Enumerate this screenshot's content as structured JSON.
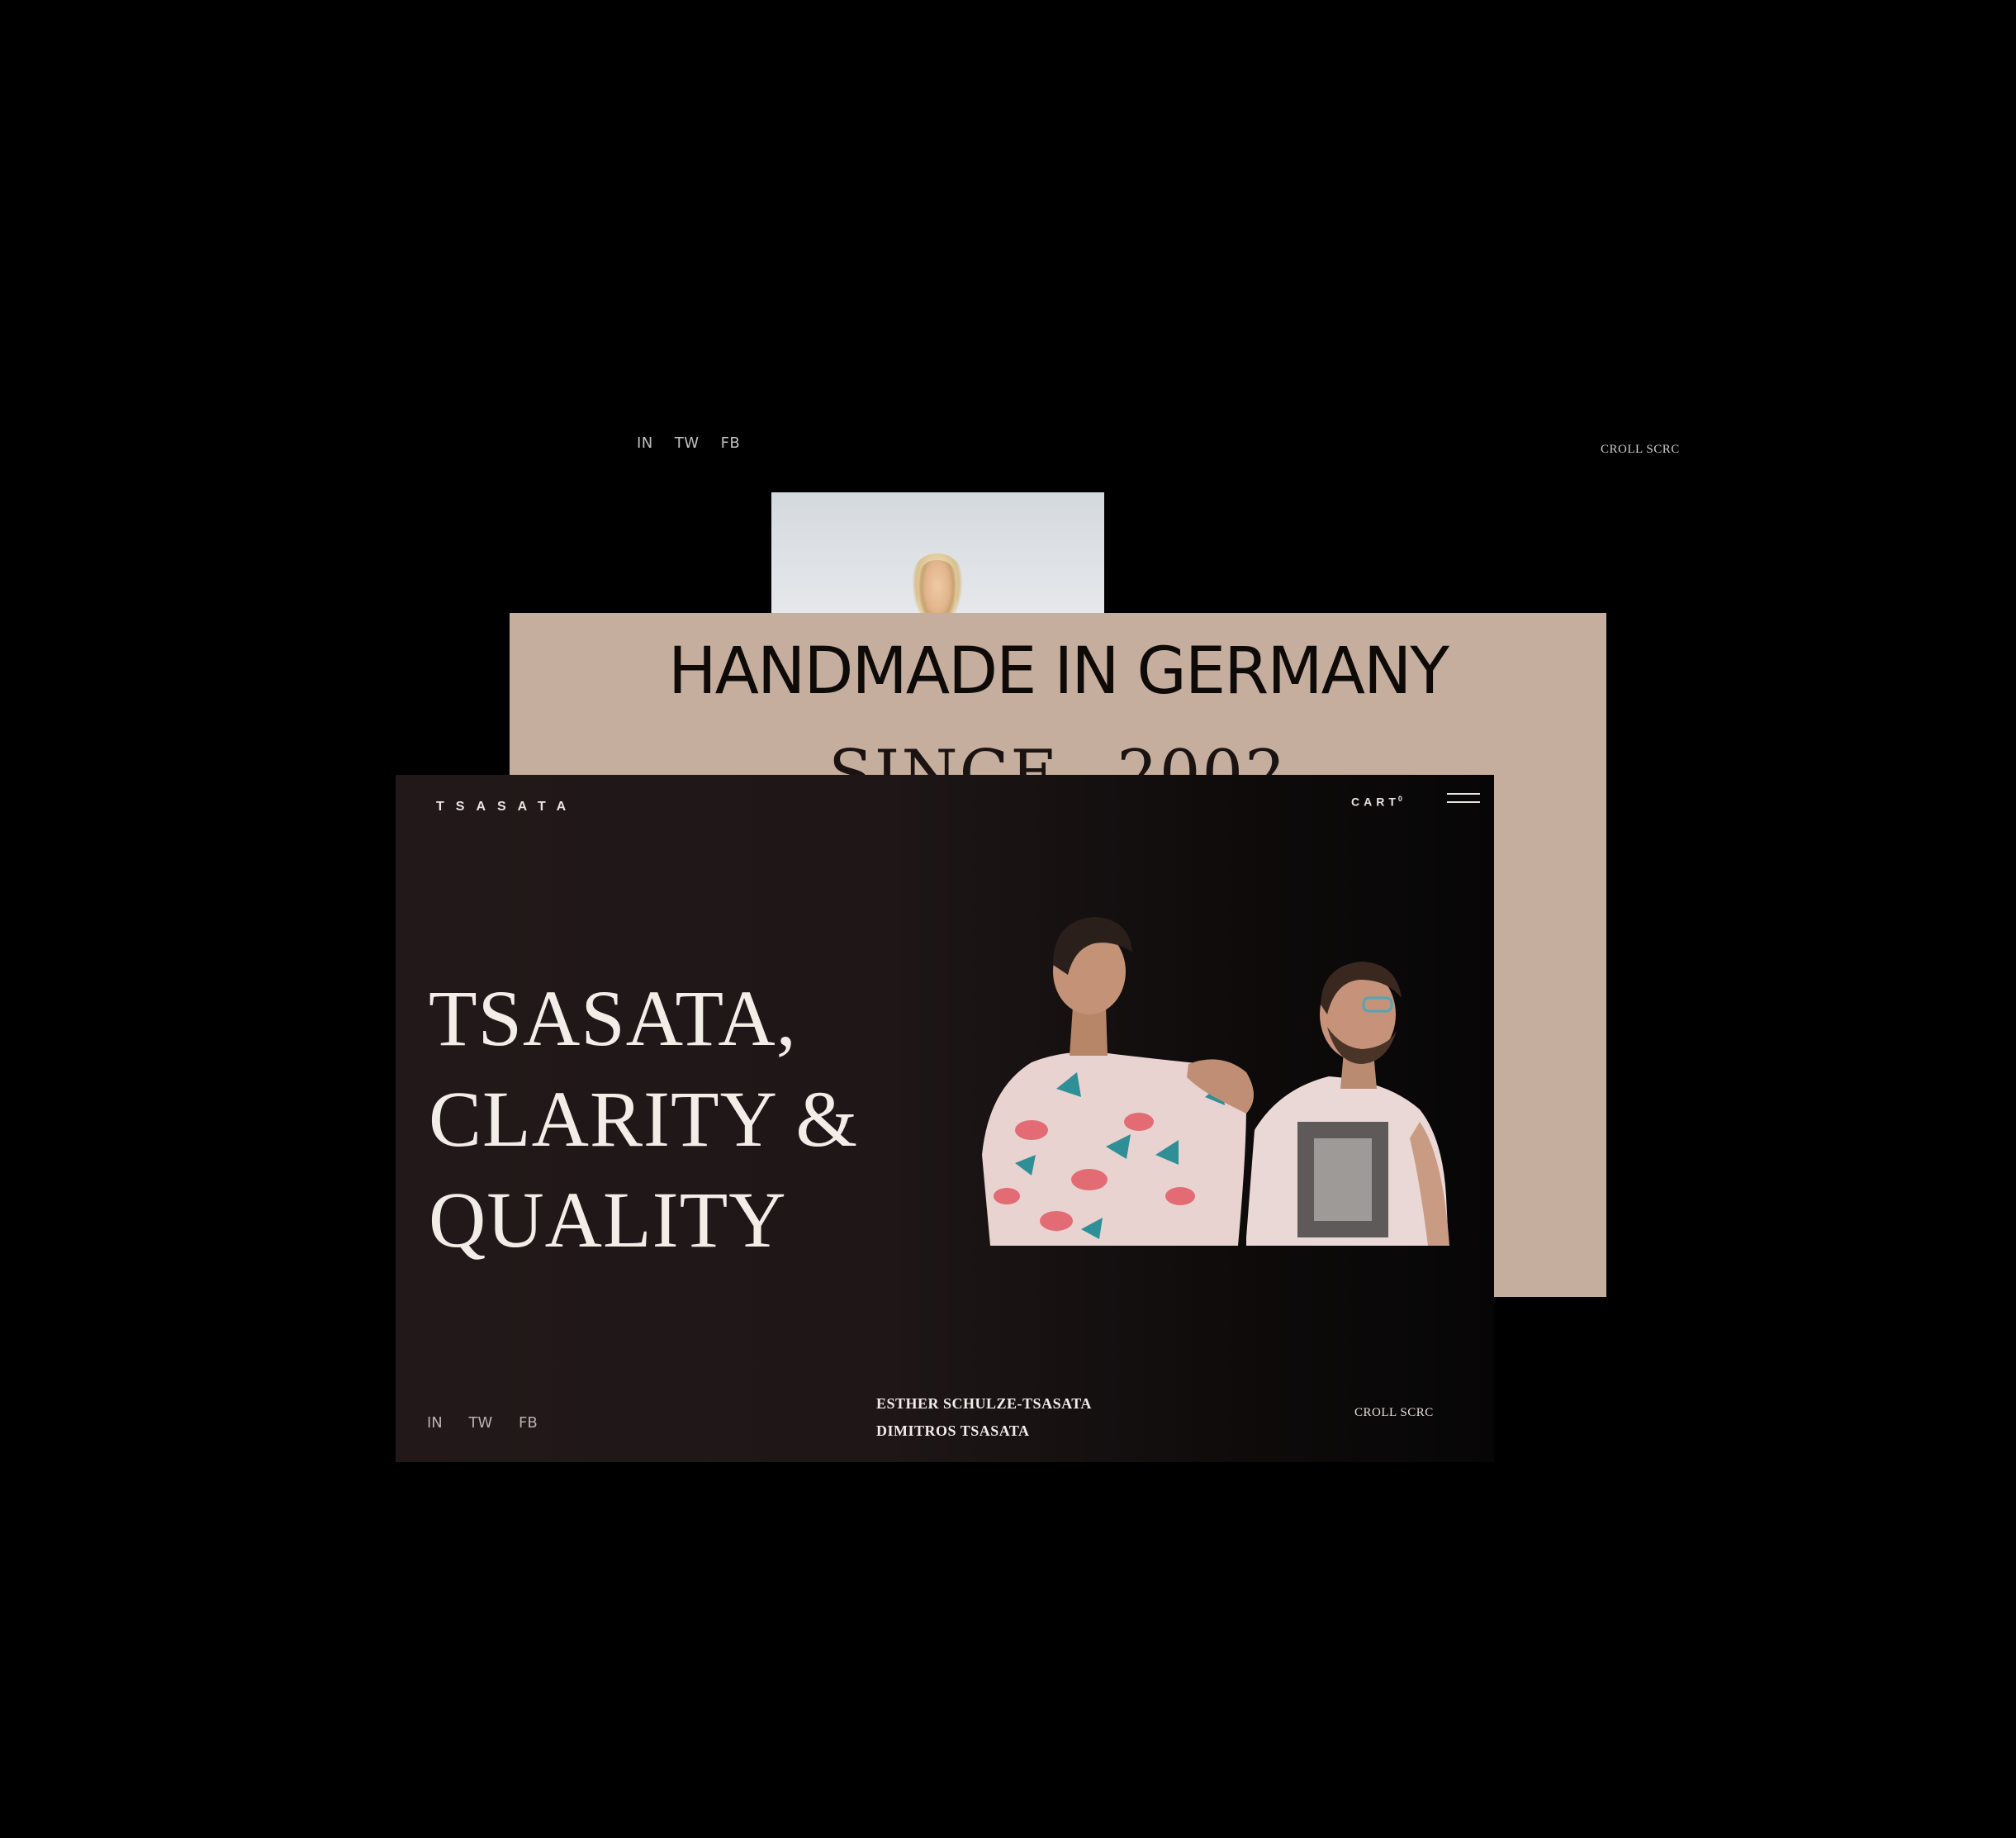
{
  "back_layer": {
    "social": [
      "IN",
      "TW",
      "FB"
    ],
    "scroll_label": "CROLL SCRC"
  },
  "beige_panel": {
    "title": "HANDMADE IN GERMANY",
    "since_label": "SINCE",
    "since_year": "2002"
  },
  "header": {
    "logo": "TSASATA",
    "cart_label": "CART",
    "cart_count": "0"
  },
  "hero": {
    "line1": "TSASATA,",
    "line2": "CLARITY &",
    "line3": "QUALITY"
  },
  "footer": {
    "social": [
      "IN",
      "TW",
      "FB"
    ],
    "names": [
      "ESTHER SCHULZE-TSASATA",
      "DIMITROS TSASATA"
    ],
    "scroll_label": "CROLL SCRC"
  },
  "colors": {
    "page_background": "#000000",
    "beige": "#c5ae9e",
    "card_dark": "#1e1617",
    "text_light": "#f3ede7"
  },
  "icons": [
    "hamburger-menu-icon"
  ]
}
